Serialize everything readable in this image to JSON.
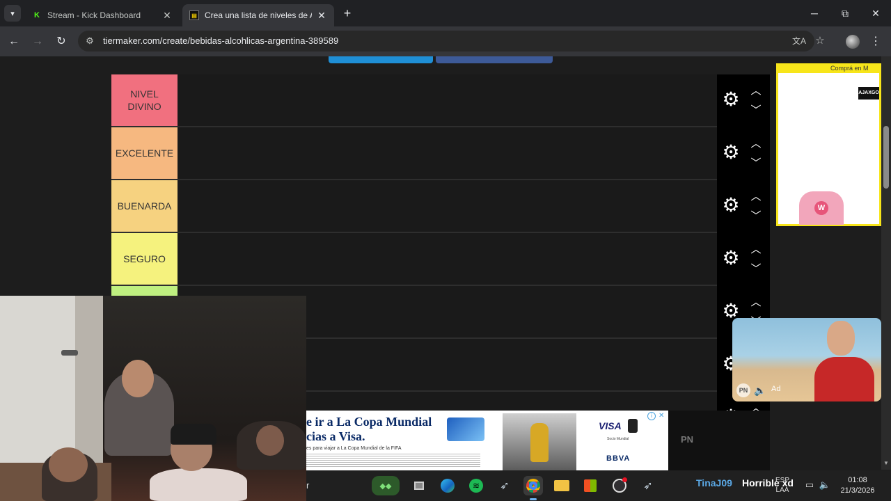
{
  "browser": {
    "tabs": [
      {
        "title": "Stream - Kick Dashboard",
        "favicon": "kick-icon",
        "active": false
      },
      {
        "title": "Crea una lista de niveles de Alc",
        "favicon": "tiermaker-icon",
        "active": true
      }
    ],
    "tab_menu_icon": "chevron-down-icon",
    "new_tab_label": "+",
    "window_controls": {
      "minimize": "─",
      "maximize": "⧉",
      "close": "✕"
    },
    "url": "tiermaker.com/create/bebidas-alcohlicas-argentina-389589"
  },
  "tier_list": {
    "tiers": [
      {
        "label": "NIVEL DIVINO",
        "color": "#f1707f"
      },
      {
        "label": "EXCELENTE",
        "color": "#f6b880"
      },
      {
        "label": "BUENARDA",
        "color": "#f6d280"
      },
      {
        "label": "SEGURO",
        "color": "#f5f27e"
      },
      {
        "label": "",
        "color": "#bff080"
      },
      {
        "label": "",
        "color": "#7ef57f"
      },
      {
        "label": "",
        "color": "#7ff6f6"
      }
    ]
  },
  "side_ad": {
    "top_text": "Comprá en M",
    "brand": "AJAXGO",
    "bag_logo": "W"
  },
  "bottom_ad": {
    "line1": "e ir a La Copa Mundial",
    "line2": "cias a Visa.",
    "line3": "es para viajar a La Copa Mundial de la FIFA",
    "visa": "VISA",
    "subline": "Socio Mundial",
    "bbva": "BBVA"
  },
  "pn_box": {
    "label": "PN"
  },
  "video_ad": {
    "pn_label": "PN",
    "ad_label": "Ad"
  },
  "taskbar": {
    "search_edge": "r",
    "overlay_username": "TinaJ09",
    "overlay_message": "Horrible xd",
    "lang_line1": "ESP",
    "lang_line2": "LAA",
    "time": "01:08",
    "date": "21/3/2026"
  },
  "colors": {
    "tier_controls_bg": "#000000",
    "page_bg": "#1d1d1d",
    "overlay_name": "#5ba9e6"
  }
}
